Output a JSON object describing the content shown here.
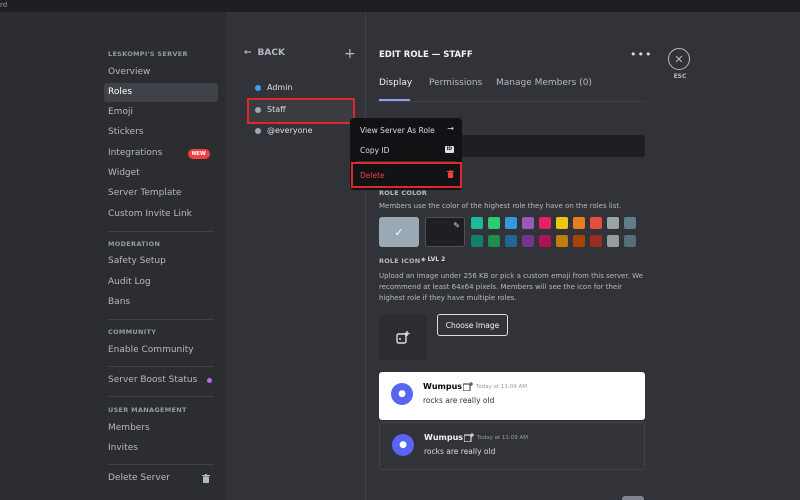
{
  "window": {
    "title_fragment": "rd"
  },
  "sidebar": {
    "server_header": "LESKOMPI'S SERVER",
    "items_a": [
      "Overview",
      "Roles",
      "Emoji",
      "Stickers",
      "Integrations",
      "Widget",
      "Server Template",
      "Custom Invite Link"
    ],
    "new_badge": "NEW",
    "moderation_header": "MODERATION",
    "items_b": [
      "Safety Setup",
      "Audit Log",
      "Bans"
    ],
    "community_header": "COMMUNITY",
    "items_c": [
      "Enable Community"
    ],
    "boost_item": "Server Boost Status",
    "user_header": "USER MANAGEMENT",
    "items_d": [
      "Members",
      "Invites"
    ],
    "delete_item": "Delete Server"
  },
  "roles_panel": {
    "back_label": "BACK",
    "roles": [
      {
        "name": "Admin",
        "color": "#3ba0f0"
      },
      {
        "name": "Staff",
        "color": "#99aab5"
      },
      {
        "name": "@everyone",
        "color": "#99aab5"
      }
    ]
  },
  "edit": {
    "title": "EDIT ROLE — STAFF",
    "esc_label": "ESC",
    "tabs": [
      "Display",
      "Permissions",
      "Manage Members (0)"
    ]
  },
  "context_menu": {
    "view_as": "View Server As Role",
    "copy_id": "Copy ID",
    "id_badge": "ID",
    "delete": "Delete"
  },
  "role_color": {
    "label": "ROLE COLOR",
    "desc": "Members use the color of the highest role they have on the roles list.",
    "default_color": "#99aab5",
    "swatches_top": [
      "#1abc9c",
      "#2ecc71",
      "#3498db",
      "#9b59b6",
      "#e91e63",
      "#f1c40f",
      "#e67e22",
      "#e74c3c",
      "#95a5a6",
      "#607d8b"
    ],
    "swatches_bottom": [
      "#11806a",
      "#1f8b4c",
      "#206694",
      "#71368a",
      "#ad1457",
      "#c27c0e",
      "#a84300",
      "#992d22",
      "#979c9f",
      "#546e7a"
    ]
  },
  "role_icon": {
    "label": "ROLE ICON",
    "level": "LVL 2",
    "desc_lines": [
      "Upload an image under 256 KB or pick a custom emoji from this server. We",
      "recommend at least 64x64 pixels. Members will see the icon for their",
      "highest role if they have multiple roles."
    ],
    "choose_button": "Choose Image"
  },
  "preview": {
    "name": "Wumpus",
    "time": "Today at 11:09 AM",
    "text": "rocks are really old"
  },
  "colors": {
    "accent": "#949cf7",
    "danger": "#f23f43",
    "highlight_box": "#e0282b"
  }
}
